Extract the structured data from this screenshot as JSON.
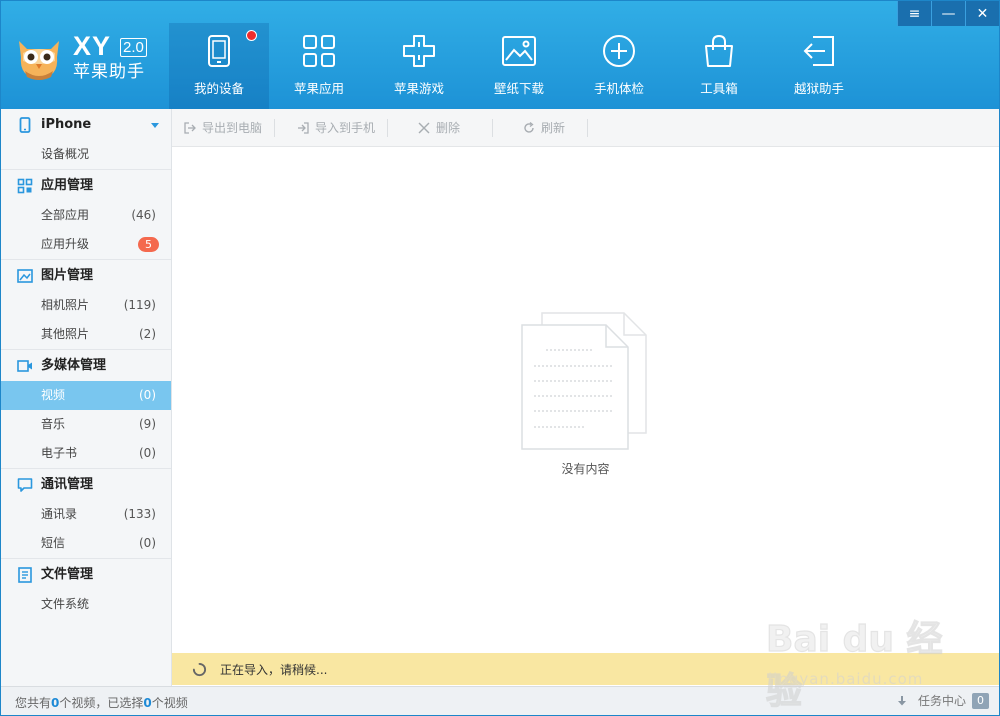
{
  "brand": {
    "xy": "XY",
    "version": "2.0",
    "name": "苹果助手"
  },
  "nav": [
    {
      "label": "我的设备",
      "icon": "tablet-icon",
      "active": true,
      "dot": true
    },
    {
      "label": "苹果应用",
      "icon": "apps-grid-icon"
    },
    {
      "label": "苹果游戏",
      "icon": "gamepad-icon"
    },
    {
      "label": "壁纸下载",
      "icon": "image-icon"
    },
    {
      "label": "手机体检",
      "icon": "plus-circle-icon"
    },
    {
      "label": "工具箱",
      "icon": "toolbox-icon"
    },
    {
      "label": "越狱助手",
      "icon": "exit-arrow-icon"
    }
  ],
  "window_controls": {
    "menu": "≡",
    "minimize": "—",
    "close": "✕"
  },
  "sidebar": {
    "device": {
      "label": "iPhone",
      "icon": "phone-icon"
    },
    "device_items": [
      {
        "label": "设备概况"
      }
    ],
    "groups": [
      {
        "label": "应用管理",
        "icon": "apps-icon",
        "items": [
          {
            "label": "全部应用",
            "count": "(46)"
          },
          {
            "label": "应用升级",
            "badge": "5"
          }
        ]
      },
      {
        "label": "图片管理",
        "icon": "picture-icon",
        "items": [
          {
            "label": "相机照片",
            "count": "(119)"
          },
          {
            "label": "其他照片",
            "count": "(2)"
          }
        ]
      },
      {
        "label": "多媒体管理",
        "icon": "video-camera-icon",
        "items": [
          {
            "label": "视频",
            "count": "(0)",
            "active": true
          },
          {
            "label": "音乐",
            "count": "(9)"
          },
          {
            "label": "电子书",
            "count": "(0)"
          }
        ]
      },
      {
        "label": "通讯管理",
        "icon": "chat-icon",
        "items": [
          {
            "label": "通讯录",
            "count": "(133)"
          },
          {
            "label": "短信",
            "count": "(0)"
          }
        ]
      },
      {
        "label": "文件管理",
        "icon": "document-icon",
        "items": [
          {
            "label": "文件系统"
          }
        ]
      }
    ]
  },
  "toolbar": {
    "export": "导出到电脑",
    "import": "导入到手机",
    "delete": "删除",
    "refresh": "刷新"
  },
  "content": {
    "empty_text": "没有内容"
  },
  "status": {
    "text": "正在导入，请稍候..."
  },
  "footer": {
    "prefix": "您共有",
    "total": "0",
    "mid": "个视频，已选择",
    "selected": "0",
    "suffix": "个视频",
    "task_label": "任务中心",
    "task_count": "0"
  },
  "watermark": {
    "brand": "Bai du 经验",
    "url": "jingyan.baidu.com"
  },
  "colors": {
    "header": "#1d92d6",
    "active_item": "#79c6ef",
    "status_bg": "#f9e7a2",
    "badge": "#f4694e",
    "nav_dot": "#f02c2c"
  }
}
